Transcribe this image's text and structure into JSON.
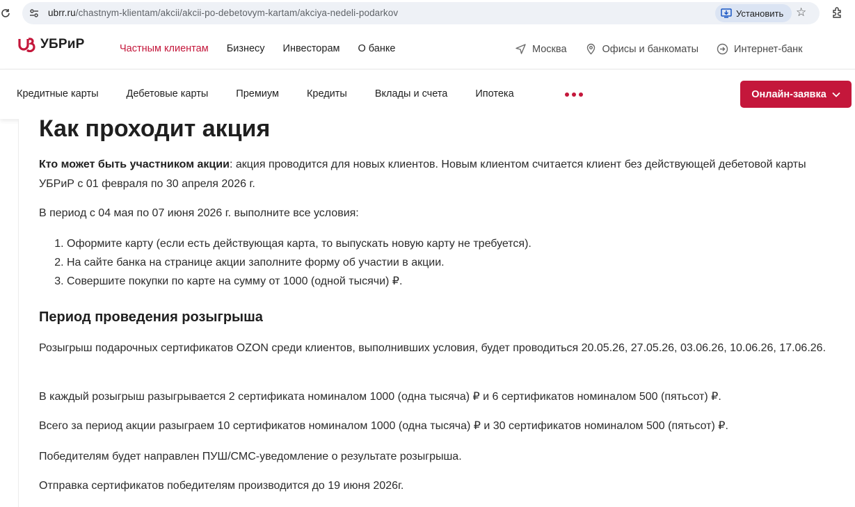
{
  "browser": {
    "url_host": "ubrr.ru",
    "url_path": "/chastnym-klientam/akcii/akcii-po-debetovym-kartam/akciya-nedeli-podarkov",
    "install_label": "Установить"
  },
  "site": {
    "logo_text": "УБРиР",
    "brand_color": "#c4173b",
    "top_nav": [
      "Частным клиентам",
      "Бизнесу",
      "Инвесторам",
      "О банке"
    ],
    "top_tools": {
      "city": "Москва",
      "offices": "Офисы и банкоматы",
      "internet_bank": "Интернет-банк"
    },
    "product_nav": [
      "Кредитные карты",
      "Дебетовые карты",
      "Премиум",
      "Кредиты",
      "Вклады и счета",
      "Ипотека"
    ],
    "apply_label": "Онлайн-заявка"
  },
  "article": {
    "heading": "Как проходит акция",
    "p1_bold": "Кто может быть участником акции",
    "p1_rest": ": акция проводится для новых клиентов. Новым клиентом считается клиент без действующей дебетовой карты УБРиР с 01 февраля по 30 апреля 2026 г.",
    "p2": "В период с 04 мая по 07 июня 2026 г. выполните все условия:",
    "steps": [
      "Оформите карту (если есть действующая карта, то выпускать новую карту не требуется).",
      "На сайте банка на странице акции заполните форму об участии в акции.",
      "Совершите покупки по карте на сумму от 1000 (одной тысячи) ₽."
    ],
    "subheading": "Период проведения розыгрыша",
    "p3": "Розыгрыш подарочных сертификатов OZON среди клиентов, выполнивших условия, будет проводиться 20.05.26, 27.05.26, 03.06.26, 10.06.26, 17.06.26.",
    "p4": "В каждый розыгрыш разыгрывается 2 сертификата номиналом 1000 (одна тысяча) ₽ и 6 сертификатов номиналом 500 (пятьсот) ₽.",
    "p5": "Всего за период акции разыграем 10 сертификатов номиналом 1000 (одна тысяча) ₽ и 30 сертификатов номиналом 500 (пятьсот) ₽.",
    "p6": "Победителям будет направлен ПУШ/СМС-уведомление о результате розыгрыша.",
    "p7": "Отправка сертификатов победителям производится до 19 июня 2026г."
  }
}
